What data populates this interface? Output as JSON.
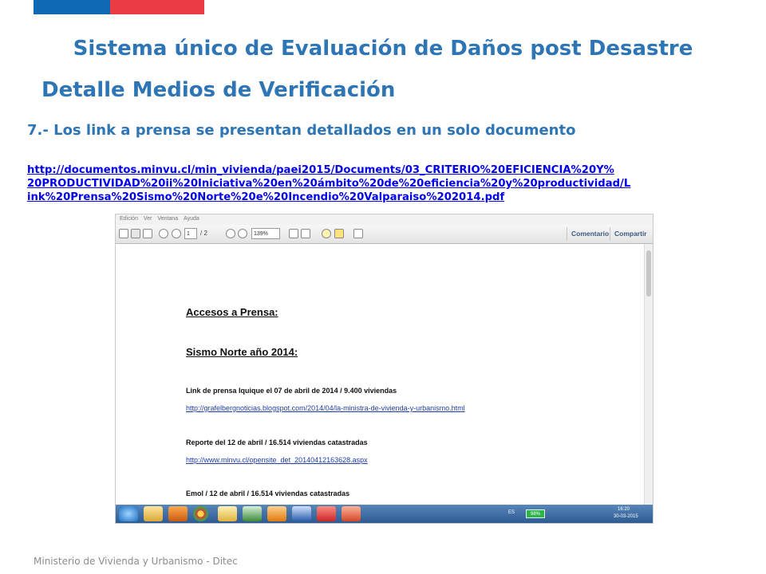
{
  "slide": {
    "title_line1": "Sistema único de  Evaluación de Daños post Desastre",
    "title_line2": "Detalle  Medios de Verificación",
    "subtitle": "7.- Los link a prensa se presentan detallados en un solo documento",
    "link_lines": [
      "http://documentos.minvu.cl/min_vivienda/paei2015/Documents/03_CRITERIO%20EFICIENCIA%20Y%",
      "20PRODUCTIVIDAD%20ii%20Iniciativa%20en%20ámbito%20de%20eficiencia%20y%20productividad/L",
      "ink%20Prensa%20Sismo%20Norte%20e%20Incendio%20Valparaiso%202014.pdf"
    ],
    "footer": "Ministerio de Vivienda y Urbanismo - Ditec"
  },
  "colors": {
    "flag_blue": "#0f69b4",
    "flag_red": "#eb3c46",
    "title": "#2e75b6",
    "link": "#0000ee"
  },
  "viewer": {
    "menu": [
      "Edición",
      "Ver",
      "Ventana",
      "Ayuda"
    ],
    "page_current": "1",
    "page_total": "/ 2",
    "zoom": "139%",
    "comment_button": "Comentario",
    "share_button": "Compartir",
    "toolbar_icons": [
      "save-icon",
      "print-icon",
      "email-icon",
      "prev-page-icon",
      "next-page-icon",
      "zoom-out-icon",
      "zoom-in-icon",
      "fit-page-icon",
      "fit-width-icon",
      "comment-icon",
      "highlight-icon",
      "expand-icon"
    ]
  },
  "document": {
    "heading1": "Accesos a Prensa:",
    "heading2": "Sismo Norte año 2014:",
    "entries": [
      {
        "text": "Link de prensa  Iquique el 07 de abril de 2014 / 9.400 viviendas",
        "url": "http://grafelbergnoticias.blogspot.com/2014/04/la-ministra-de-vivienda-y-urbanismo.html"
      },
      {
        "text": "Reporte del 12 de abril / 16.514 viviendas catastradas",
        "url": "http://www.minvu.cl/opensite_det_20140412163628.aspx"
      },
      {
        "text": "Emol / 12 de abril / 16.514 viviendas catastradas",
        "url": ""
      }
    ]
  },
  "taskbar": {
    "apps": [
      "ie-icon",
      "folder-icon",
      "media-icon",
      "chrome-icon",
      "explorer-icon",
      "project-icon",
      "outlook-icon",
      "word-icon",
      "acrobat-icon",
      "powerpoint-icon"
    ],
    "language": "ES",
    "battery": "98%",
    "time": "16:20",
    "date": "30-03-2015"
  }
}
